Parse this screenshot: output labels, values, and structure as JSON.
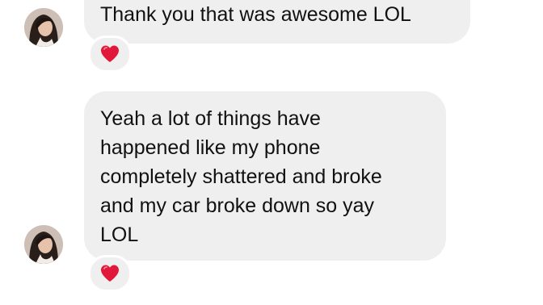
{
  "conversation": {
    "messages": [
      {
        "text": "Thank you that was awesome LOL",
        "reaction": "red-heart-icon"
      },
      {
        "text": "Yeah a lot of things have\nhappened like my phone\ncompletely shattered and broke\nand my car broke down so yay\nLOL",
        "reaction": "red-heart-icon"
      }
    ]
  },
  "colors": {
    "bubble_background": "#efefef",
    "page_background": "#ffffff",
    "heart": "#e0193a"
  }
}
